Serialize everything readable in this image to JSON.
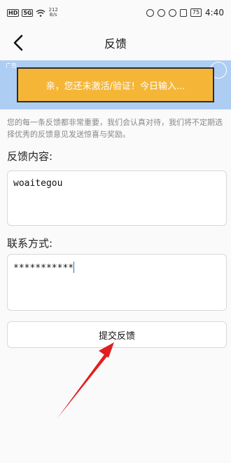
{
  "status_bar": {
    "hd": "HD",
    "signal": "5G",
    "net_speed_value": "212",
    "net_speed_unit": "B/s",
    "battery": "75",
    "time": "4:40"
  },
  "header": {
    "title": "反馈"
  },
  "banner": {
    "tag": "广告",
    "text": "亲，您还未激活/验证！今日输入..."
  },
  "notice": "您的每一条反馈都非常重要，我们会认真对待，我们将不定期选择优秀的反馈意见发送惊喜与奖励。",
  "form": {
    "content_label": "反馈内容:",
    "content_value": "woaitegou",
    "contact_label": "联系方式:",
    "contact_value": "***********",
    "submit_label": "提交反馈"
  },
  "colors": {
    "banner_bg": "#aecdf3",
    "banner_card": "#f5b638",
    "annotation_arrow": "#e02020"
  }
}
